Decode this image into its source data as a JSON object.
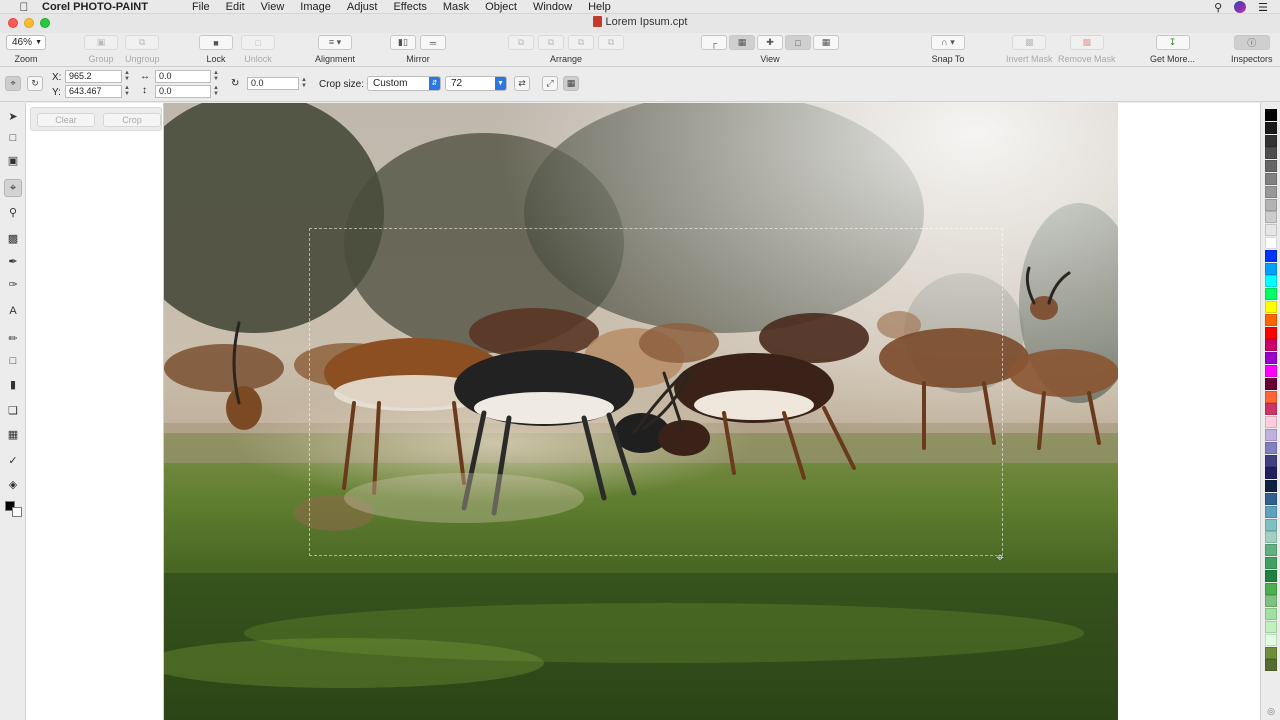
{
  "menubar": {
    "app_name": "Corel PHOTO-PAINT",
    "menus": [
      "File",
      "Edit",
      "View",
      "Image",
      "Adjust",
      "Effects",
      "Mask",
      "Object",
      "Window",
      "Help"
    ]
  },
  "window": {
    "title": "Lorem Ipsum.cpt"
  },
  "toolbar": {
    "zoom_value": "46%",
    "zoom_label": "Zoom",
    "group_label": "Group",
    "ungroup_label": "Ungroup",
    "lock_label": "Lock",
    "unlock_label": "Unlock",
    "alignment_label": "Alignment",
    "mirror_label": "Mirror",
    "arrange_label": "Arrange",
    "view_label": "View",
    "snapto_label": "Snap To",
    "invertmask_label": "Invert Mask",
    "removemask_label": "Remove Mask",
    "getmore_label": "Get More...",
    "inspectors_label": "Inspectors"
  },
  "propbar": {
    "x_label": "X:",
    "x_value": "965.2",
    "y_label": "Y:",
    "y_value": "643.467",
    "width_value": "0.0",
    "height_value": "0.0",
    "rotation_value": "0.0",
    "cropsize_label": "Crop size:",
    "cropsize_value": "Custom",
    "resolution_value": "72"
  },
  "sidepanel": {
    "clear_label": "Clear",
    "crop_label": "Crop"
  },
  "tools": [
    "pick-tool",
    "mask-rectangle-tool",
    "mask-transform-tool",
    "crop-tool",
    "zoom-tool",
    "clone-tool",
    "touchup-brush-tool",
    "red-eye-tool",
    "text-tool",
    "paint-tool",
    "rectangle-tool",
    "eraser-tool",
    "object-transparency-tool",
    "interactive-fill-tool",
    "eyedropper-tool",
    "fill-tool"
  ],
  "palette_colors": [
    "#000000",
    "#1a1a1a",
    "#333333",
    "#4d4d4d",
    "#666666",
    "#808080",
    "#999999",
    "#b3b3b3",
    "#cccccc",
    "#e6e6e6",
    "#ffffff",
    "#0033ff",
    "#00a0ff",
    "#00ffff",
    "#00ff66",
    "#ffff00",
    "#ff6600",
    "#ff0000",
    "#cc0066",
    "#9900cc",
    "#ff00ff",
    "#660033",
    "#ff6633",
    "#cc3366",
    "#ffccdd",
    "#c0b0e0",
    "#8080c0",
    "#404080",
    "#202060",
    "#102040",
    "#306090",
    "#60a0c0",
    "#80c0c0",
    "#a0d0c0",
    "#60b080",
    "#40a060",
    "#208040",
    "#4caf50",
    "#80c080",
    "#a0e0a0",
    "#c0f0c0",
    "#e0ffe0",
    "#6d8f3a",
    "#556b2f"
  ]
}
